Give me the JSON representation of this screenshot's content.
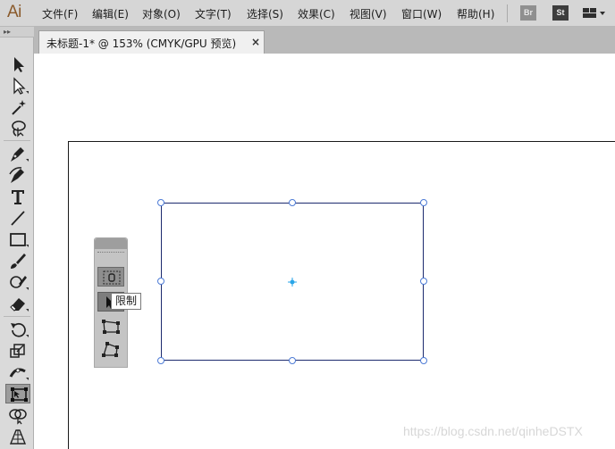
{
  "app": {
    "logo": "Ai"
  },
  "menu": {
    "items": [
      {
        "label": "文件(F)"
      },
      {
        "label": "编辑(E)"
      },
      {
        "label": "对象(O)"
      },
      {
        "label": "文字(T)"
      },
      {
        "label": "选择(S)"
      },
      {
        "label": "效果(C)"
      },
      {
        "label": "视图(V)"
      },
      {
        "label": "窗口(W)"
      },
      {
        "label": "帮助(H)"
      }
    ],
    "bridge_label": "Br",
    "stock_label": "St"
  },
  "toolbar": {
    "grip": "▸▸",
    "tools": [
      {
        "icon": "selection-tool-icon"
      },
      {
        "icon": "direct-selection-tool-icon"
      },
      {
        "icon": "magic-wand-tool-icon"
      },
      {
        "icon": "lasso-tool-icon"
      },
      {
        "icon": "pen-tool-icon"
      },
      {
        "icon": "curvature-tool-icon"
      },
      {
        "icon": "type-tool-icon"
      },
      {
        "icon": "line-segment-tool-icon"
      },
      {
        "icon": "rectangle-tool-icon"
      },
      {
        "icon": "paintbrush-tool-icon"
      },
      {
        "icon": "blob-brush-tool-icon"
      },
      {
        "icon": "eraser-tool-icon"
      },
      {
        "icon": "rotate-tool-icon"
      },
      {
        "icon": "scale-tool-icon"
      },
      {
        "icon": "width-tool-icon"
      },
      {
        "icon": "free-transform-tool-icon"
      },
      {
        "icon": "shape-builder-tool-icon"
      },
      {
        "icon": "perspective-grid-tool-icon"
      }
    ],
    "active_tool": "free-transform-tool-icon"
  },
  "document": {
    "tab_title": "未标题-1* @ 153% (CMYK/GPU 预览)",
    "close_glyph": "×"
  },
  "float_panel": {
    "tools": [
      {
        "icon": "constrain-icon"
      },
      {
        "icon": "free-transform-icon"
      },
      {
        "icon": "perspective-distort-icon"
      },
      {
        "icon": "free-distort-icon"
      }
    ],
    "tooltip": "限制"
  },
  "watermark": "https://blog.csdn.net/qinheDSTX",
  "colors": {
    "selection_border": "#1c2a6e",
    "handle_stroke": "#4d7bd6",
    "center_point": "#2aa6e8"
  }
}
